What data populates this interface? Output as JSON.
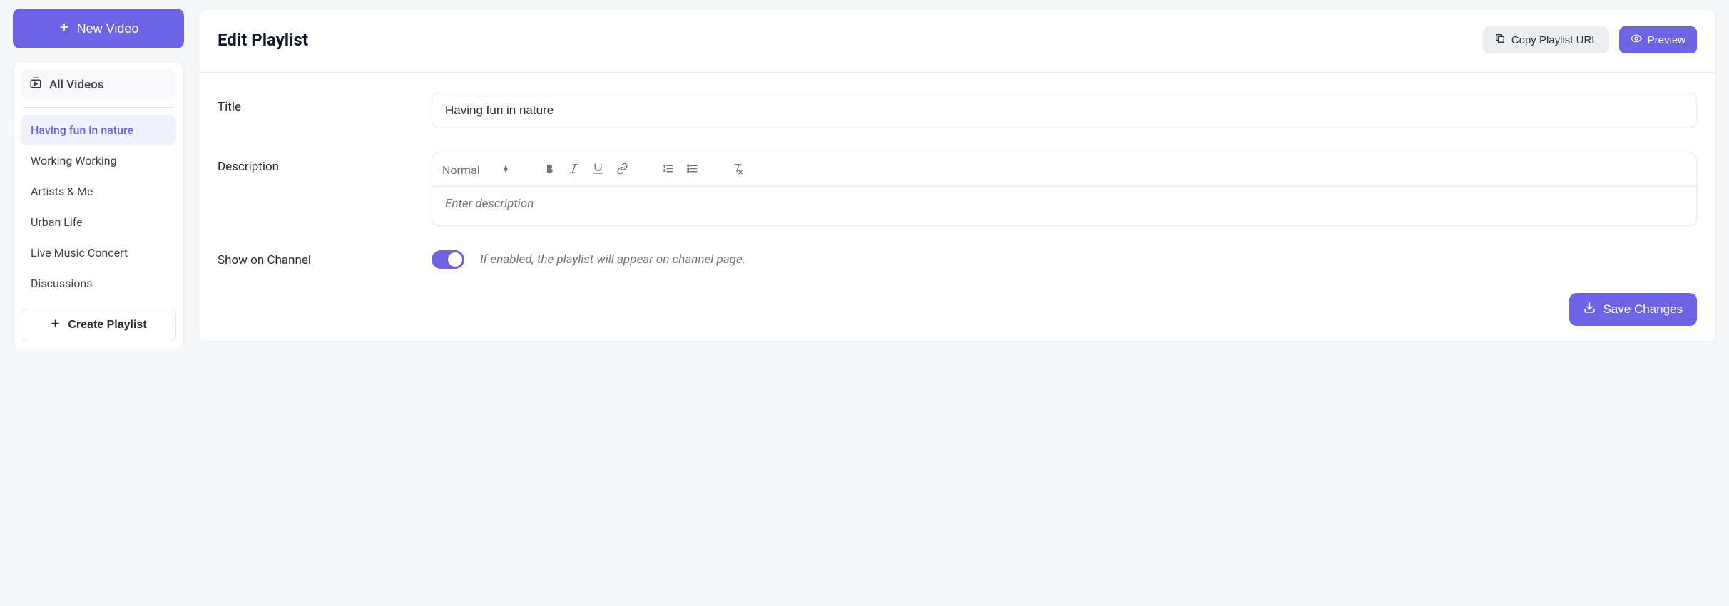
{
  "sidebar": {
    "new_video_label": "New Video",
    "all_videos_label": "All Videos",
    "playlists": [
      {
        "label": "Having fun in nature",
        "active": true
      },
      {
        "label": "Working Working",
        "active": false
      },
      {
        "label": "Artists & Me",
        "active": false
      },
      {
        "label": "Urban Life",
        "active": false
      },
      {
        "label": "Live Music Concert",
        "active": false
      },
      {
        "label": "Discussions",
        "active": false
      }
    ],
    "create_playlist_label": "Create Playlist"
  },
  "header": {
    "title": "Edit Playlist",
    "copy_url_label": "Copy Playlist URL",
    "preview_label": "Preview"
  },
  "form": {
    "title_label": "Title",
    "title_value": "Having fun in nature",
    "description_label": "Description",
    "description_placeholder": "Enter description",
    "format_select_label": "Normal",
    "show_on_channel_label": "Show on Channel",
    "show_on_channel_enabled": true,
    "show_on_channel_help": "If enabled, the playlist will appear on channel page."
  },
  "footer": {
    "save_label": "Save Changes"
  },
  "icons": {
    "plus": "plus-icon",
    "video_library": "video-library-icon",
    "copy": "copy-icon",
    "eye": "eye-icon",
    "bold": "bold-icon",
    "italic": "italic-icon",
    "underline": "underline-icon",
    "link": "link-icon",
    "ol": "ordered-list-icon",
    "ul": "unordered-list-icon",
    "clear": "clear-format-icon",
    "download": "save-icon"
  }
}
